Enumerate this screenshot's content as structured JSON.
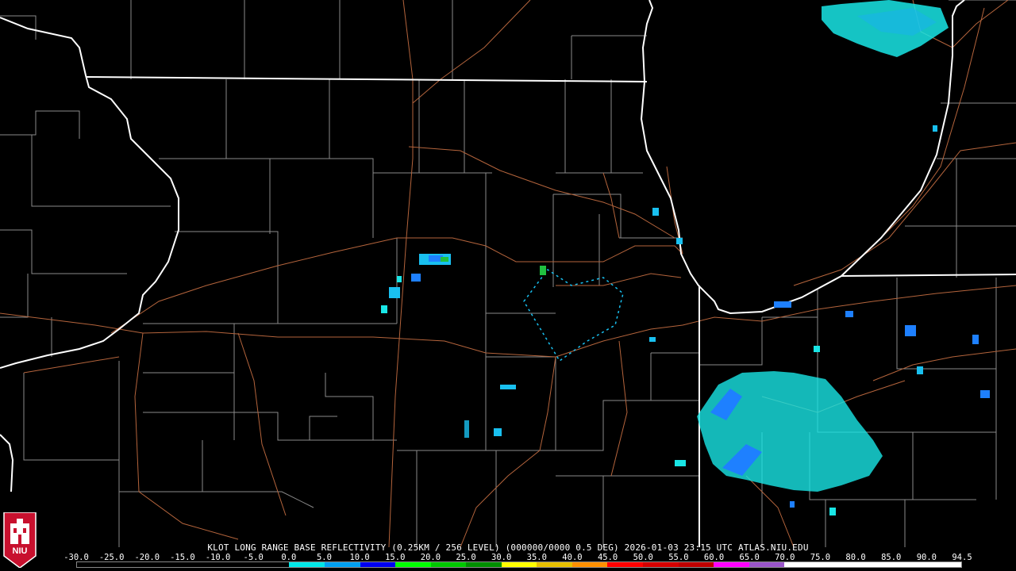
{
  "caption": "KLOT LONG RANGE BASE REFLECTIVITY (0.25KM / 256 LEVEL) (000000/0000 0.5 DEG) 2026-01-03 23:15 UTC  ATLAS.NIU.EDU",
  "scale": {
    "ticks": [
      "-30.0",
      "-25.0",
      "-20.0",
      "-15.0",
      "-10.0",
      "-5.0",
      "0.0",
      "5.0",
      "10.0",
      "15.0",
      "20.0",
      "25.0",
      "30.0",
      "35.0",
      "40.0",
      "45.0",
      "50.0",
      "55.0",
      "60.0",
      "65.0",
      "70.0",
      "75.0",
      "80.0",
      "85.0",
      "90.0",
      "94.5"
    ],
    "colors": [
      "#000000",
      "#000000",
      "#000000",
      "#000000",
      "#000000",
      "#000000",
      "#00e6e6",
      "#00a0f0",
      "#0000f0",
      "#00ff00",
      "#00c800",
      "#009000",
      "#ffff00",
      "#e7c000",
      "#ff9000",
      "#ff0000",
      "#d60000",
      "#c00000",
      "#ff00ff",
      "#9955c9",
      "#ffffff",
      "#ffffff",
      "#ffffff",
      "#ffffff",
      "#ffffff"
    ]
  },
  "logo": {
    "text": "NIU",
    "color": "#c8102e"
  },
  "map_colors": {
    "state": "#ffffff",
    "county": "#8a8a8a",
    "road": "#b4643c",
    "echo_light": "#19e6e6",
    "echo_mid": "#1e90ff",
    "echo_strong": "#2040ff",
    "echo_green": "#20c040"
  }
}
